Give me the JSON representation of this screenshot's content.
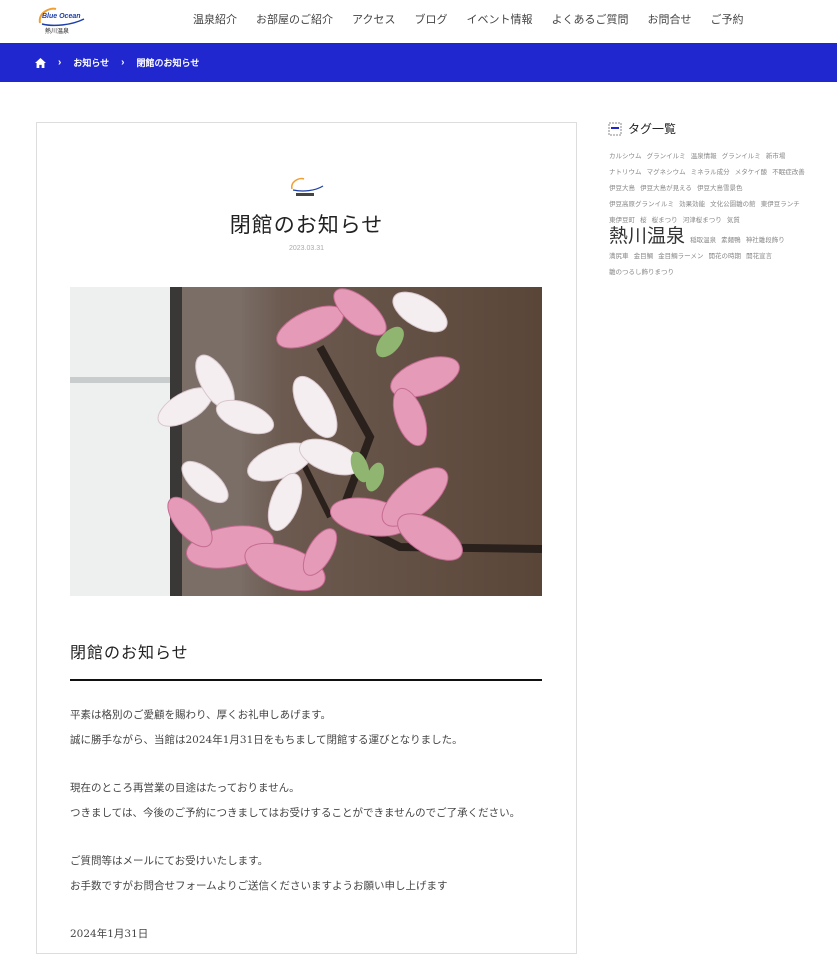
{
  "brand": {
    "logo_text": "Blue Ocean",
    "logo_sub": "熱川温泉"
  },
  "nav": [
    "温泉紹介",
    "お部屋のご紹介",
    "アクセス",
    "ブログ",
    "イベント情報",
    "よくあるご質問",
    "お問合せ",
    "ご予約"
  ],
  "breadcrumb": {
    "home_icon": "home-icon",
    "items": [
      "お知らせ",
      "閉館のお知らせ"
    ]
  },
  "post": {
    "title": "閉館のお知らせ",
    "date": "2023.03.31",
    "heading": "閉館のお知らせ",
    "paragraphs": [
      [
        "平素は格別のご愛顧を賜わり、厚くお礼申しあげます。",
        "誠に勝手ながら、当館は2024年1月31日をもちまして閉館する運びとなりました。"
      ],
      [
        "現在のところ再営業の目途はたっておりません。",
        "つきましては、今後のご予約につきましてはお受けすることができませんのでご了承ください。"
      ],
      [
        "ご質問等はメールにてお受けいたします。",
        "お手数ですがお問合せフォームよりご送信くださいますようお願い申し上げます"
      ],
      [
        "2024年1月31日"
      ]
    ]
  },
  "sidebar": {
    "tag_title": "タグ一覧",
    "tags_before": [
      "カルシウム",
      "グランイルミ",
      "温泉情報",
      "グランイルミ",
      "新市場",
      "ナトリウム",
      "マグネシウム",
      "ミネラル成分",
      "メタケイ酸",
      "不眠症改善",
      "伊豆大島",
      "伊豆大島が見える",
      "伊豆大島雪景色",
      "伊豆高原グランイルミ",
      "効果効能",
      "文化公園雛の館",
      "東伊豆ランチ",
      "東伊豆町",
      "桜",
      "桜まつり",
      "河津桜まつり",
      "気質"
    ],
    "tag_big": "熱川温泉",
    "tags_after": [
      "稲取温泉",
      "素麺鴨",
      "神社雛段飾り",
      "満尻車",
      "金目鯛",
      "金目鯛ラーメン",
      "開花の時期",
      "開花宣言",
      "雛のつるし飾りまつり"
    ]
  },
  "colors": {
    "accent": "#2127cf",
    "logo_blue": "#1c3fa8",
    "logo_orange": "#f0a030"
  }
}
